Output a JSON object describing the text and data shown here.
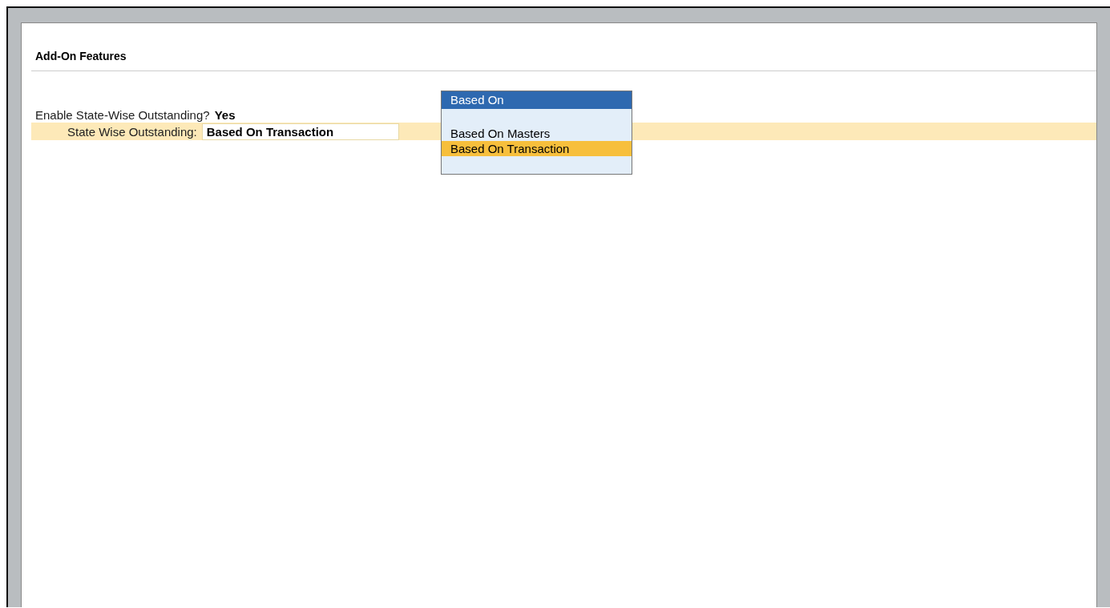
{
  "section_title": "Add-On Features",
  "fields": [
    {
      "label": "Enable State-Wise Outstanding?",
      "value": "Yes",
      "kind": "plain",
      "selected": false
    },
    {
      "label": "State Wise Outstanding:",
      "value": "Based On Transaction",
      "kind": "field",
      "selected": true
    }
  ],
  "dropdown": {
    "title": "Based On",
    "options": [
      {
        "label": "Based On Masters",
        "selected": false
      },
      {
        "label": "Based On Transaction",
        "selected": true
      }
    ]
  }
}
